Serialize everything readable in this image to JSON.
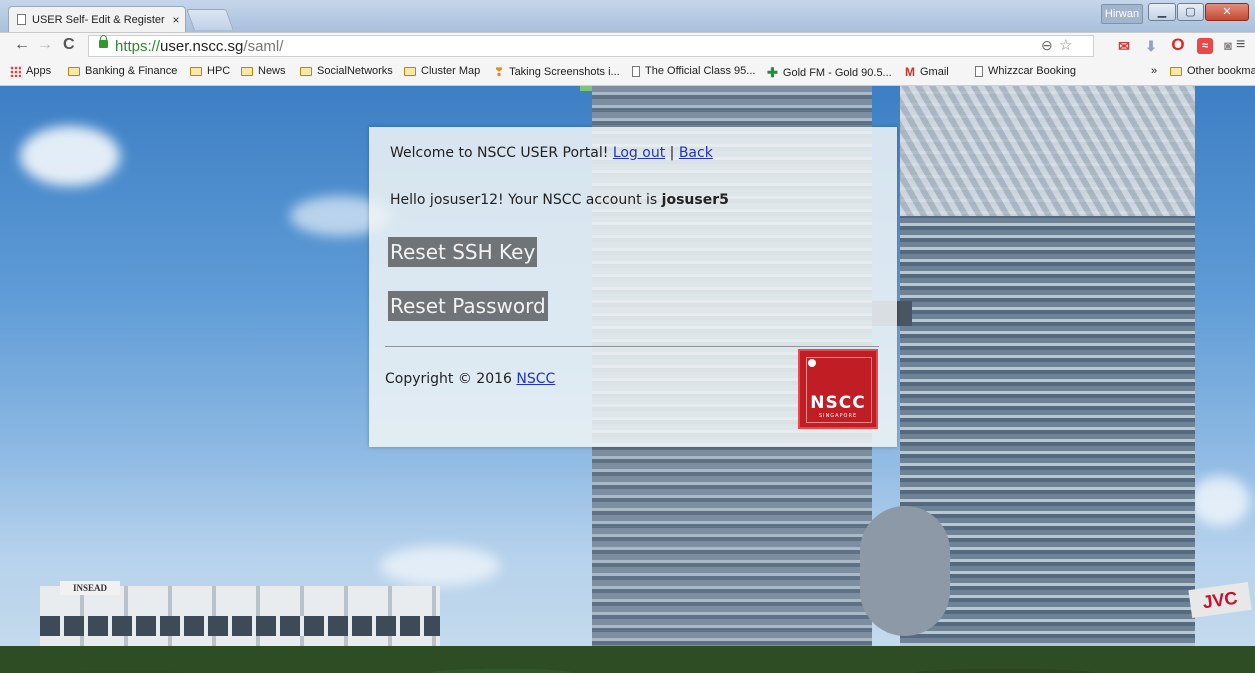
{
  "browser": {
    "tab_title": "USER Self- Edit & Register",
    "tab_close": "×",
    "user_badge": "Hirwan",
    "win_min": "▁",
    "win_max": "▢",
    "win_close": "✕",
    "url_scheme": "https://",
    "url_host": "user.nscc.sg",
    "url_path": "/saml/",
    "bookmarks": [
      {
        "label": "Apps",
        "icon": "apps-icon"
      },
      {
        "label": "Banking & Finance",
        "icon": "folder-icon"
      },
      {
        "label": "HPC",
        "icon": "folder-icon"
      },
      {
        "label": "News",
        "icon": "folder-icon"
      },
      {
        "label": "SocialNetworks",
        "icon": "folder-icon"
      },
      {
        "label": "Cluster Map",
        "icon": "folder-icon"
      },
      {
        "label": "Taking Screenshots i...",
        "icon": "hand-icon"
      },
      {
        "label": "The Official Class 95...",
        "icon": "doc-icon"
      },
      {
        "label": "Gold FM - Gold 90.5...",
        "icon": "plus-icon"
      },
      {
        "label": "Gmail",
        "icon": "gmail-icon"
      },
      {
        "label": "Whizzcar Booking",
        "icon": "doc-icon"
      }
    ],
    "overflow": "»",
    "other_bookmarks": "Other bookmarks"
  },
  "portal": {
    "welcome_text": "Welcome to NSCC USER Portal!",
    "logout_label": "Log out",
    "separator": "|",
    "back_label": "Back",
    "hello_prefix": "Hello josuser12! Your NSCC account is",
    "account_name": "josuser5",
    "reset_ssh_label": "Reset SSH Key",
    "reset_password_label": "Reset Password",
    "copyright_text": "Copyright © 2016",
    "copyright_link": "NSCC",
    "logo_text": "NSCC",
    "logo_sub": "SINGAPORE"
  }
}
